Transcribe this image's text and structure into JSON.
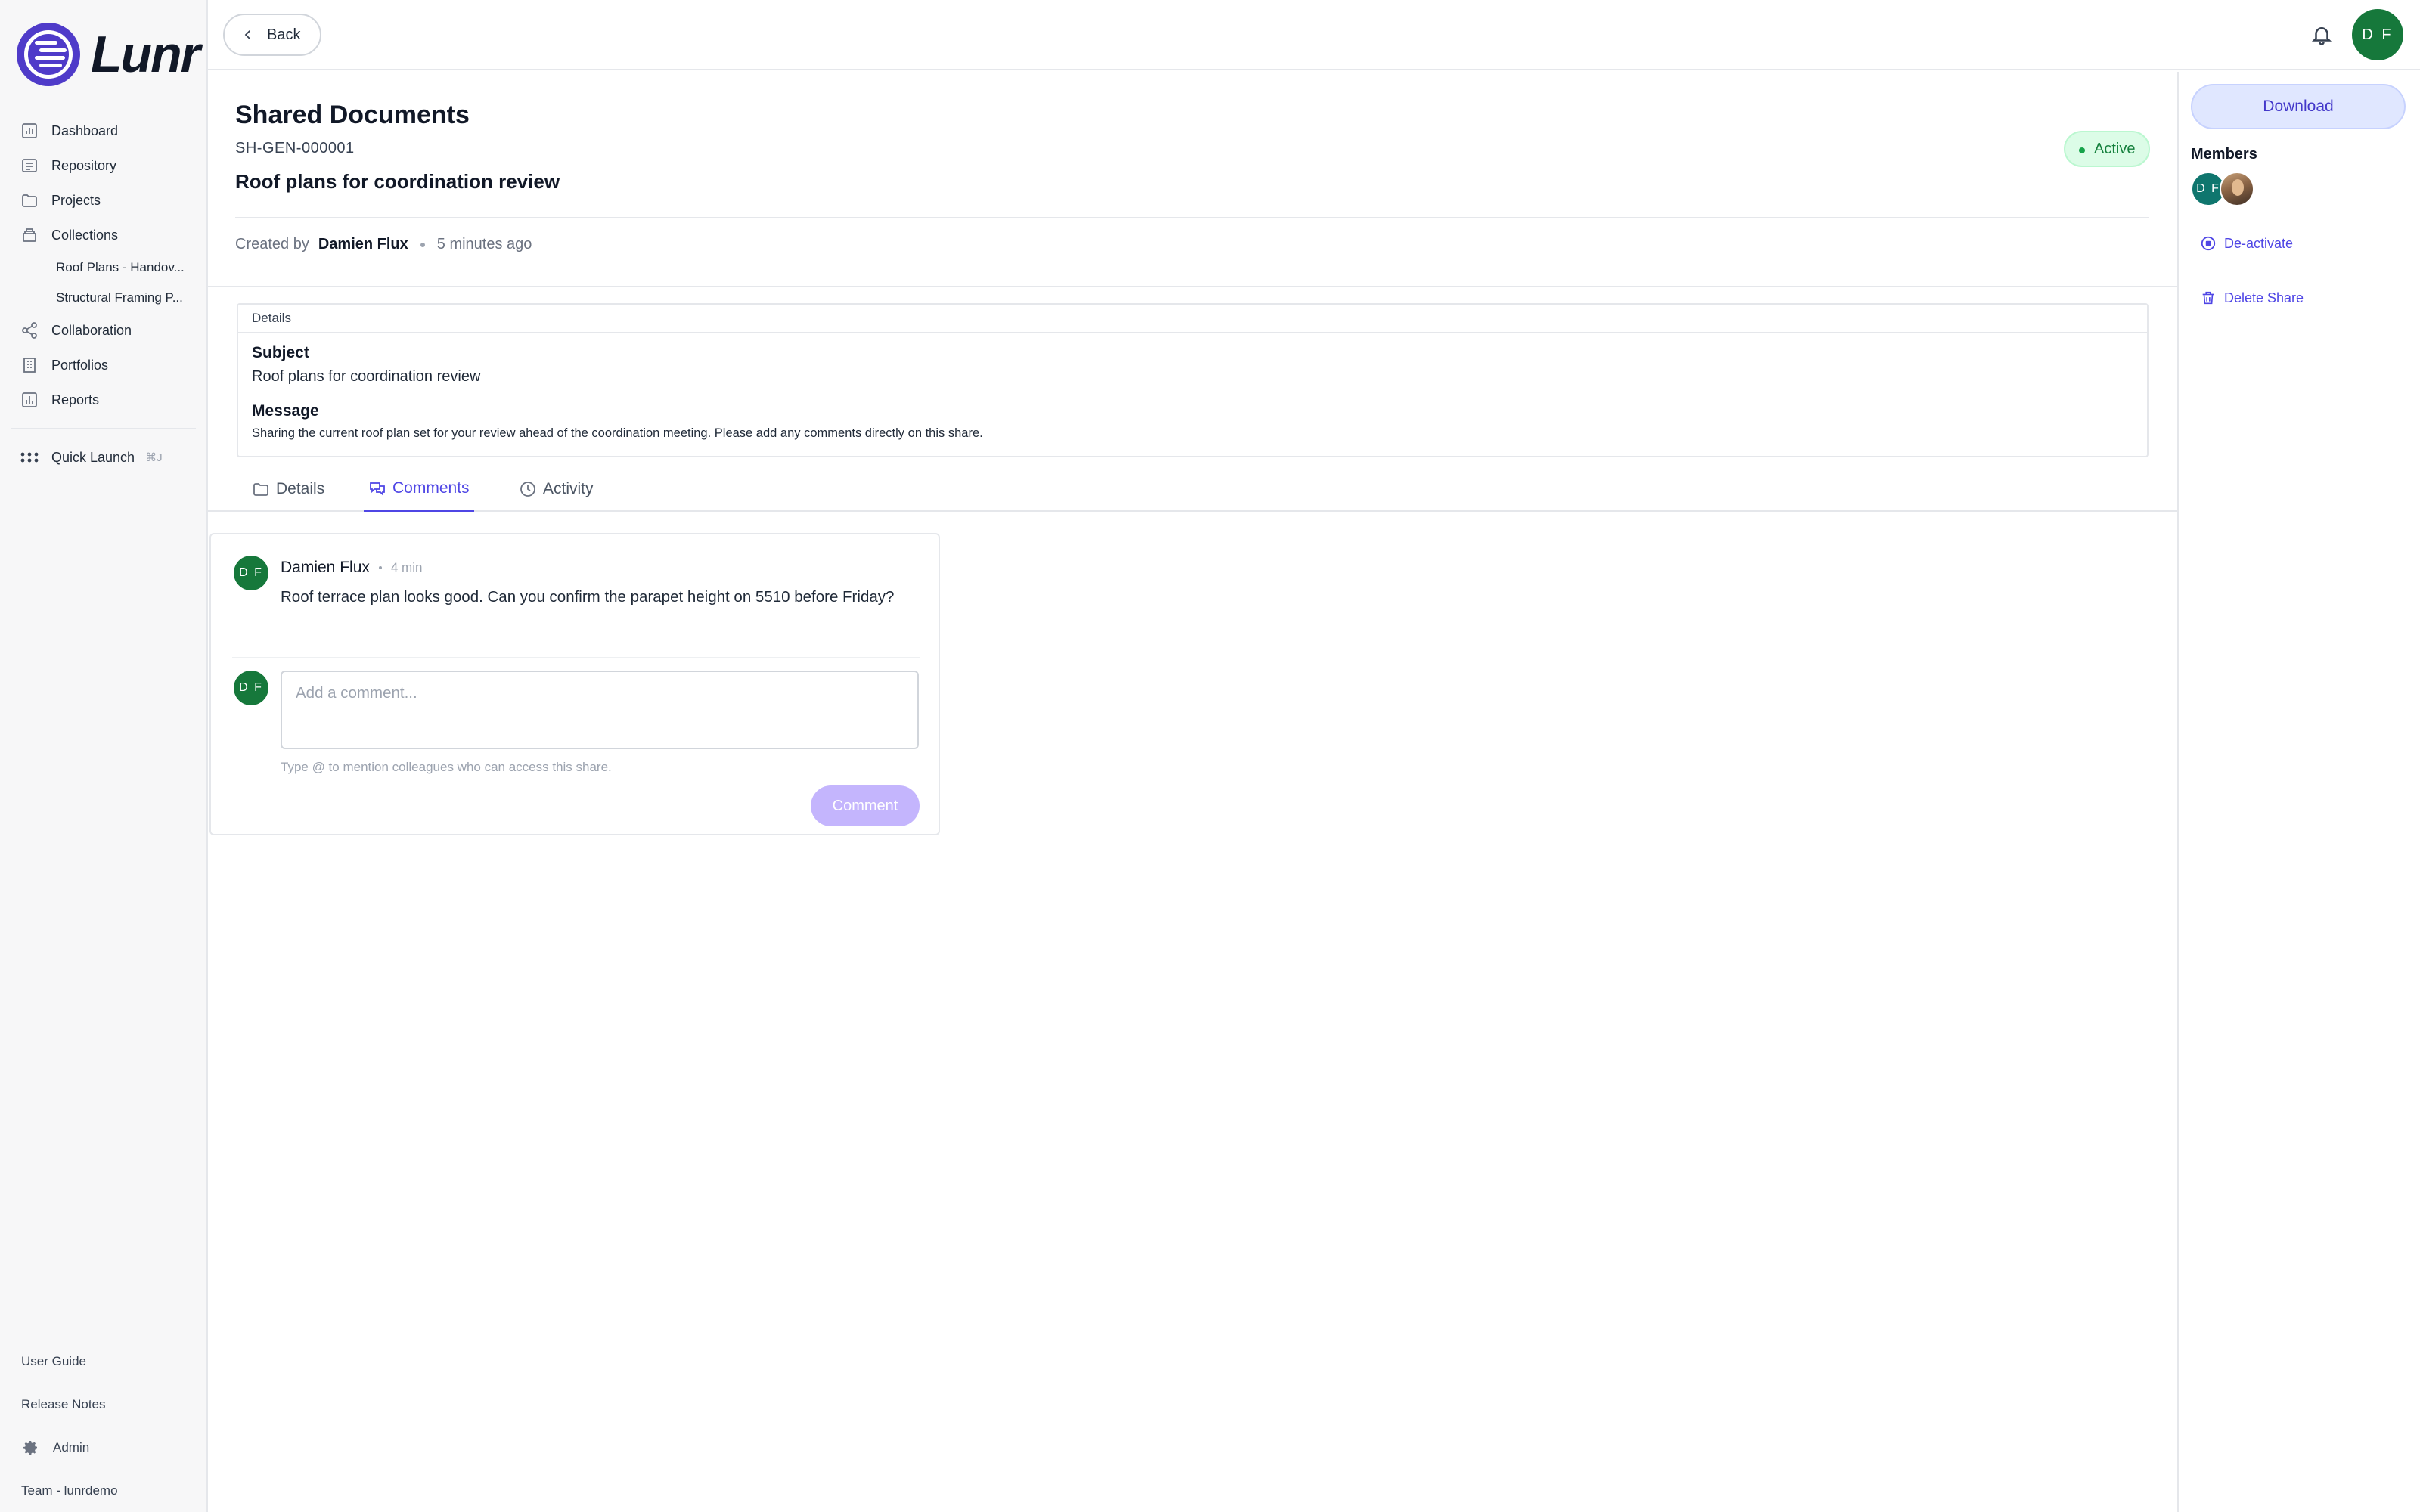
{
  "brand": {
    "name": "Lunr"
  },
  "sidebar": {
    "items": [
      {
        "label": "Dashboard",
        "icon": "chart-icon"
      },
      {
        "label": "Repository",
        "icon": "repository-icon"
      },
      {
        "label": "Projects",
        "icon": "folder-icon"
      },
      {
        "label": "Collections",
        "icon": "collection-icon"
      }
    ],
    "collections": [
      "Roof Plans - Handov...",
      "Structural Framing P..."
    ],
    "items2": [
      {
        "label": "Collaboration",
        "icon": "share-icon"
      },
      {
        "label": "Portfolios",
        "icon": "building-icon"
      },
      {
        "label": "Reports",
        "icon": "report-icon"
      }
    ],
    "quick_launch": {
      "label": "Quick Launch",
      "shortcut": "⌘J"
    },
    "bottom": {
      "user_guide": "User Guide",
      "release_notes": "Release Notes",
      "admin": "Admin",
      "team": "Team - lunrdemo"
    }
  },
  "topbar": {
    "back_label": "Back",
    "user_initials": "D F"
  },
  "share": {
    "title": "Shared Documents",
    "code": "SH-GEN-000001",
    "subject": "Roof plans for coordination review",
    "status": "Active",
    "created_by_label": "Created by",
    "created_by": "Damien Flux",
    "created_ago": "5 minutes ago"
  },
  "details": {
    "header": "Details",
    "subject_label": "Subject",
    "subject": "Roof plans for coordination review",
    "message_label": "Message",
    "message": "Sharing the current roof plan set for your review ahead of the coordination meeting. Please add any comments directly on this share."
  },
  "tabs": [
    {
      "label": "Details",
      "active": false
    },
    {
      "label": "Comments",
      "active": true
    },
    {
      "label": "Activity",
      "active": false
    }
  ],
  "comments": {
    "items": [
      {
        "initials": "D F",
        "author": "Damien Flux",
        "time": "4 min",
        "text": "Roof terrace plan looks good. Can you confirm the parapet height on 5510 before Friday?"
      }
    ],
    "composer": {
      "initials": "D F",
      "placeholder": "Add a comment...",
      "hint": "Type @ to mention colleagues who can access this share.",
      "button": "Comment"
    }
  },
  "right_panel": {
    "download": "Download",
    "members_label": "Members",
    "members": [
      {
        "initials": "D F"
      }
    ],
    "deactivate": "De-activate",
    "delete": "Delete Share"
  },
  "colors": {
    "accent": "#4f46e5",
    "brand": "#4f3bc9",
    "avatar_green": "#16783b",
    "active_green": "#15803d"
  }
}
